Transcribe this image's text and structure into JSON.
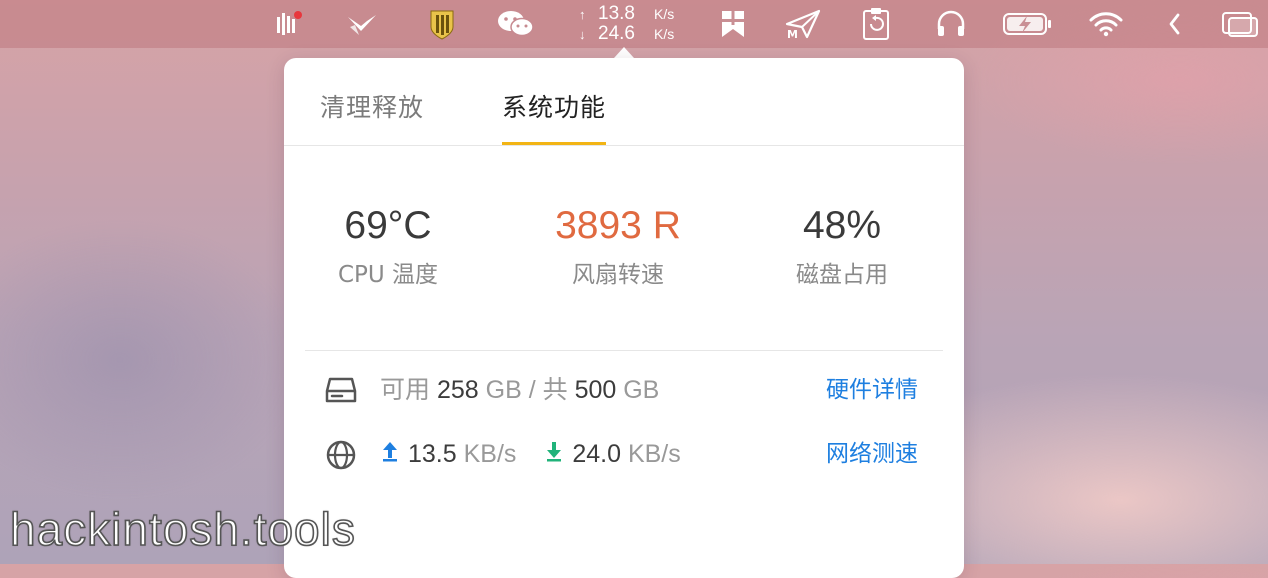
{
  "menubar": {
    "icons": [
      "stats-icon",
      "paper-plane-logo-icon",
      "shield-icon",
      "wechat-icon",
      "bookmark-icon",
      "send-icon",
      "clipboard-history-icon",
      "headphones-icon",
      "battery-charging-icon",
      "wifi-icon",
      "chevron-left-icon",
      "screens-icon"
    ],
    "net_upload": "13.8",
    "net_download": "24.6",
    "net_unit": "K/s",
    "up_arrow": "↑",
    "down_arrow": "↓"
  },
  "popover": {
    "tabs": [
      {
        "label": "清理释放",
        "active": false
      },
      {
        "label": "系统功能",
        "active": true
      }
    ],
    "stats": [
      {
        "value": "69°C",
        "label": "CPU 温度",
        "color": "#3a3a3a"
      },
      {
        "value": "3893 R",
        "label": "风扇转速",
        "color": "#e06a40"
      },
      {
        "value": "48%",
        "label": "磁盘占用",
        "color": "#3a3a3a"
      }
    ],
    "disk": {
      "available_prefix": "可用",
      "available_value": "258",
      "available_unit": "GB / 共",
      "total_value": "500",
      "total_unit": "GB",
      "link": "硬件详情"
    },
    "network": {
      "upload_value": "13.5",
      "download_value": "24.0",
      "unit": "KB/s",
      "link": "网络测速",
      "upload_color": "#1e7fe0",
      "download_color": "#21b37a"
    }
  },
  "watermark": "hackintosh.tools",
  "colors": {
    "accent_tab": "#f2b414",
    "link": "#1e7fe0"
  }
}
